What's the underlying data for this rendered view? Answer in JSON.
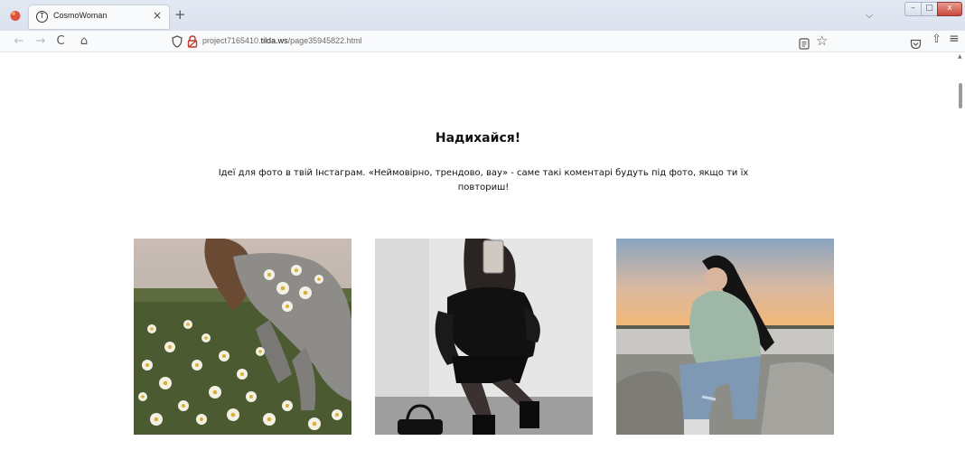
{
  "browser": {
    "tab": {
      "title": "CosmoWoman",
      "close_glyph": "×",
      "favicon": "tilda-logo-icon"
    },
    "new_tab_glyph": "+",
    "tab_list_glyph": "⌵",
    "window_controls": {
      "minimize": "–",
      "maximize": "□",
      "close": "x"
    },
    "nav": {
      "back_glyph": "←",
      "forward_glyph": "→",
      "reload_glyph": "C",
      "home_glyph": "⌂"
    },
    "url": {
      "prefix": "project7165410.",
      "domain": "tilda.ws",
      "path": "/page35945822.html"
    },
    "toolbar_right": {
      "star_glyph": "☆",
      "share_glyph": "⇧",
      "menu_glyph": "≡"
    }
  },
  "page": {
    "heading": "Надихайся!",
    "description": "Ідеї для фото в твій Інстаграм. «Неймовірно, трендово, вау» - саме такі коментарі будуть під фото, якщо ти їх повториш!",
    "photos": [
      {
        "alt": "woman-with-daisies"
      },
      {
        "alt": "woman-in-black-leather-mirror-selfie"
      },
      {
        "alt": "woman-on-rocks-at-sunset"
      }
    ]
  }
}
